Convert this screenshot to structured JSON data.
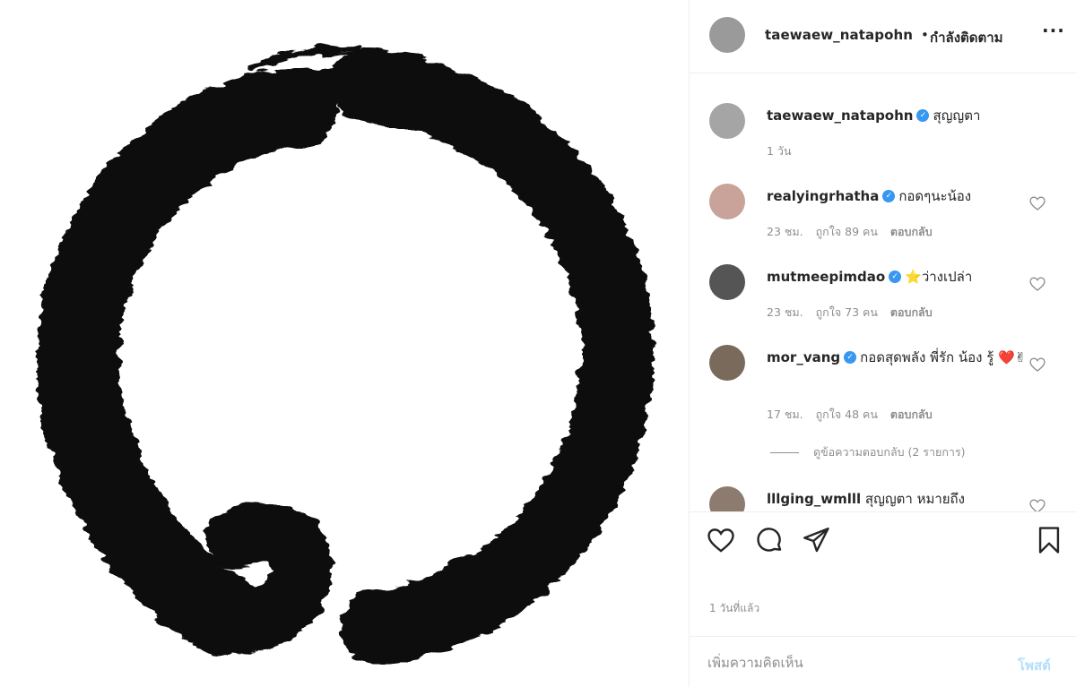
{
  "post": {
    "author": "taewaew_natapohn",
    "follow_dot": "•",
    "follow_status": "กำลังติดตาม",
    "more": "···",
    "caption": {
      "username": "taewaew_natapohn",
      "text": "สุญญตา",
      "time": "1 วัน"
    }
  },
  "comments": [
    {
      "username": "realyingrhatha",
      "text": "กอดๆนะน้อง",
      "time": "23 ชม.",
      "likes": "ถูกใจ 89 คน",
      "reply": "ตอบกลับ"
    },
    {
      "username": "mutmeepimdao",
      "text": "⭐ว่างเปล่า",
      "time": "23 ชม.",
      "likes": "ถูกใจ 73 คน",
      "reply": "ตอบกลับ"
    },
    {
      "username": "mor_vang",
      "text": "กอดสุดพลัง พี่รัก น้อง รู้ ❤️✌",
      "time": "17 ชม.",
      "likes": "ถูกใจ 48 คน",
      "reply": "ตอบกลับ"
    },
    {
      "username": "lllging_wmlll",
      "text": "สุญญตา หมายถึง"
    }
  ],
  "view_replies": "ดูข้อความตอบกลับ (2 รายการ)",
  "time_ago": "1 วันที่แล้ว",
  "add_comment": {
    "placeholder": "เพิ่มความคิดเห็น",
    "post_label": "โพสต์"
  },
  "colors": {
    "verified": "#3897f0",
    "post_disabled": "#b2dffc",
    "muted": "#8e8e8e",
    "ink": "#111111"
  },
  "icons": [
    "heart-icon",
    "comment-icon",
    "share-icon",
    "bookmark-icon",
    "verified-icon"
  ]
}
